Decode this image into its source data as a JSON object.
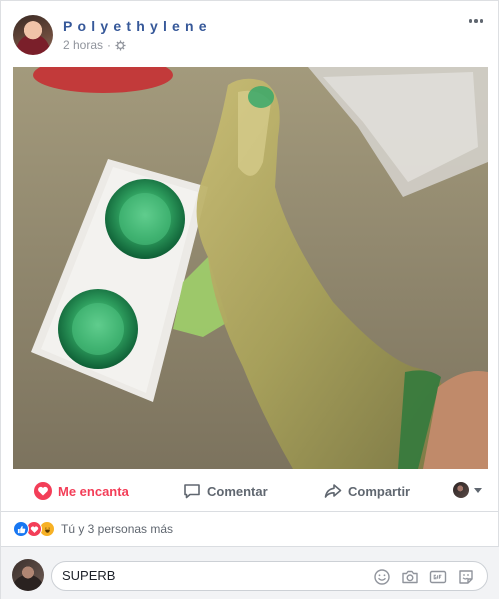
{
  "post": {
    "author": "Polyethylene",
    "time": "2 horas",
    "separator": "·",
    "privacy_icon": "gear-icon",
    "more_icon": "ellipsis-icon"
  },
  "photo": {
    "description_icon": "photo-image"
  },
  "actions": {
    "love_label": "Me encanta",
    "comment_label": "Comentar",
    "share_label": "Compartir",
    "accent_love": "#f33e58",
    "muted": "#606770"
  },
  "reactions": {
    "summary": "Tú y 3 personas más",
    "icons": [
      "like-icon",
      "love-icon",
      "haha-icon"
    ]
  },
  "composer": {
    "value": "SUPERB",
    "icons": [
      "emoji-icon",
      "camera-icon",
      "gif-icon",
      "sticker-icon"
    ]
  }
}
